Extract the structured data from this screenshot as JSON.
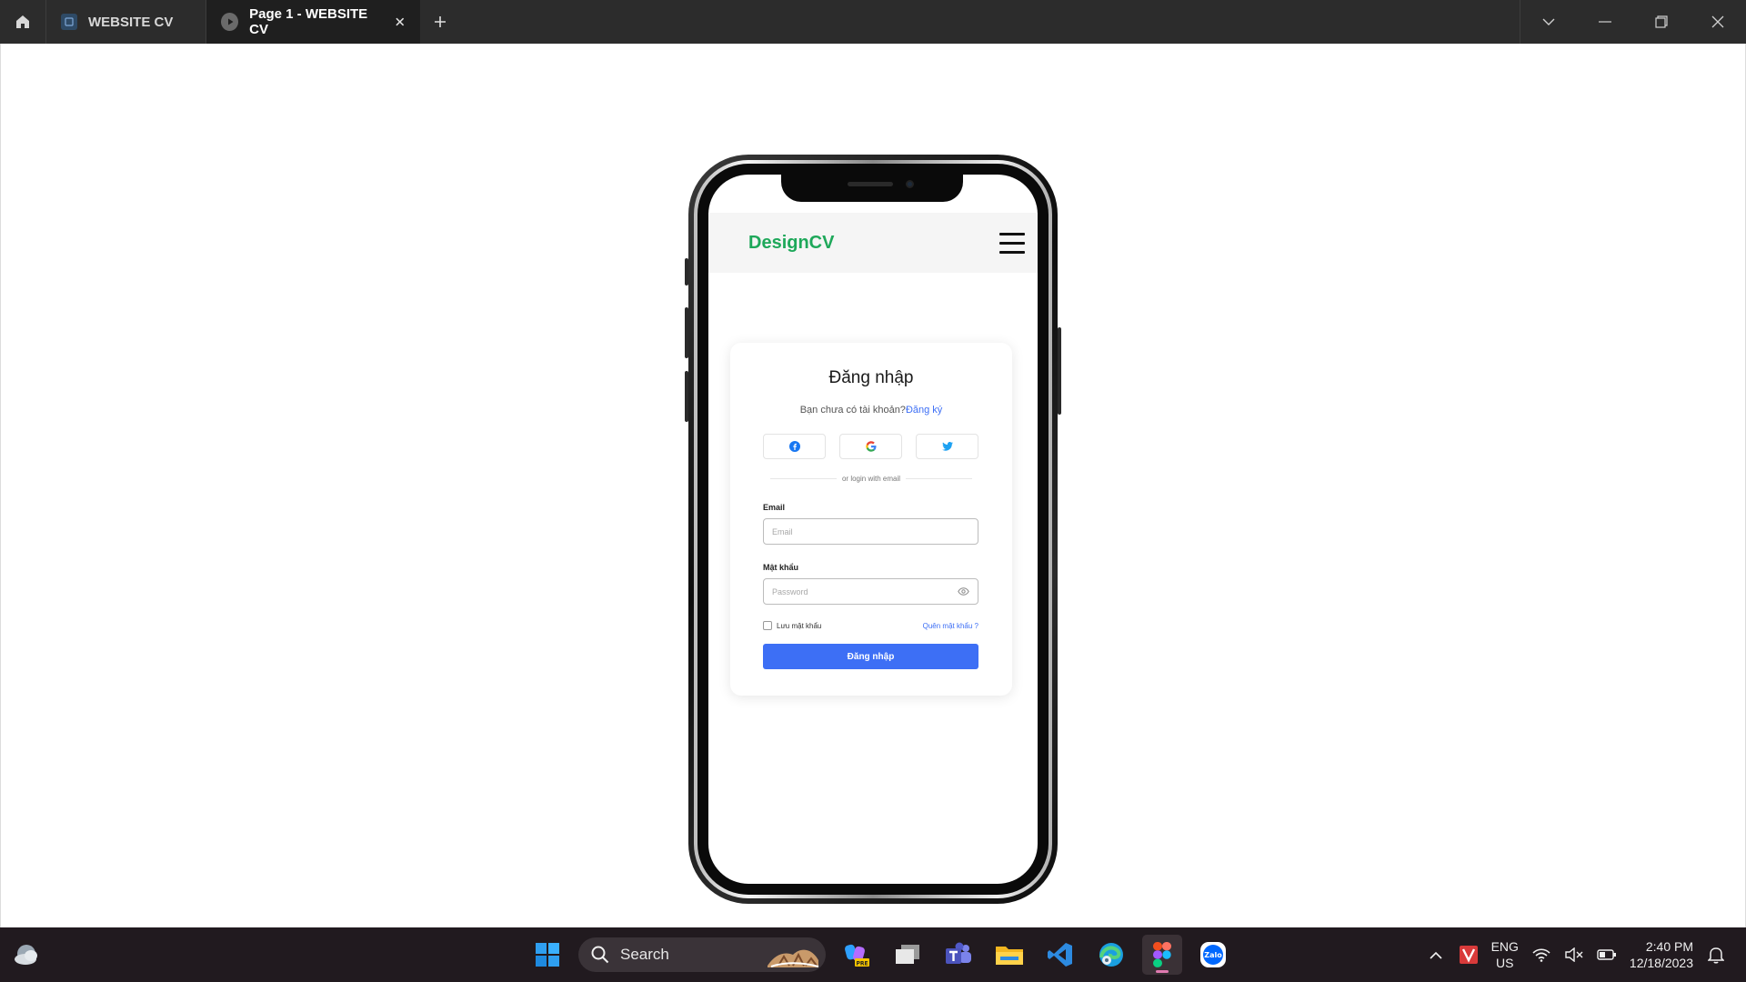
{
  "window": {
    "tabs": [
      {
        "label": "WEBSITE CV",
        "active": false
      },
      {
        "label": "Page 1 - WEBSITE CV",
        "active": true
      }
    ],
    "icons": [
      "home-icon",
      "close-icon",
      "plus-icon",
      "chevron-down-icon",
      "minimize-icon",
      "restore-icon",
      "close-window-icon"
    ]
  },
  "app": {
    "logo": "DesignCV",
    "brand_color": "#1ea85a",
    "accent_color": "#3d6ff5"
  },
  "login": {
    "title": "Đăng nhập",
    "subtitle_prefix": "Bạn chưa có tài khoản?",
    "register_link": "Đăng ký",
    "social": [
      "facebook-icon",
      "google-icon",
      "twitter-icon"
    ],
    "divider_text": "or login with email",
    "email_label": "Email",
    "email_placeholder": "Email",
    "password_label": "Mật khẩu",
    "password_placeholder": "Password",
    "remember_label": "Lưu mật khẩu",
    "forgot_link": "Quên mật khẩu ?",
    "submit_label": "Đăng nhập"
  },
  "taskbar": {
    "search_placeholder": "Search",
    "apps": [
      "start-icon",
      "copilot-icon",
      "file-manager-icon",
      "teams-icon",
      "explorer-icon",
      "vscode-icon",
      "edge-icon",
      "figma-icon",
      "zalo-icon"
    ],
    "active_app": "figma-icon",
    "lang_line1": "ENG",
    "lang_line2": "US",
    "time": "2:40 PM",
    "date": "12/18/2023"
  }
}
